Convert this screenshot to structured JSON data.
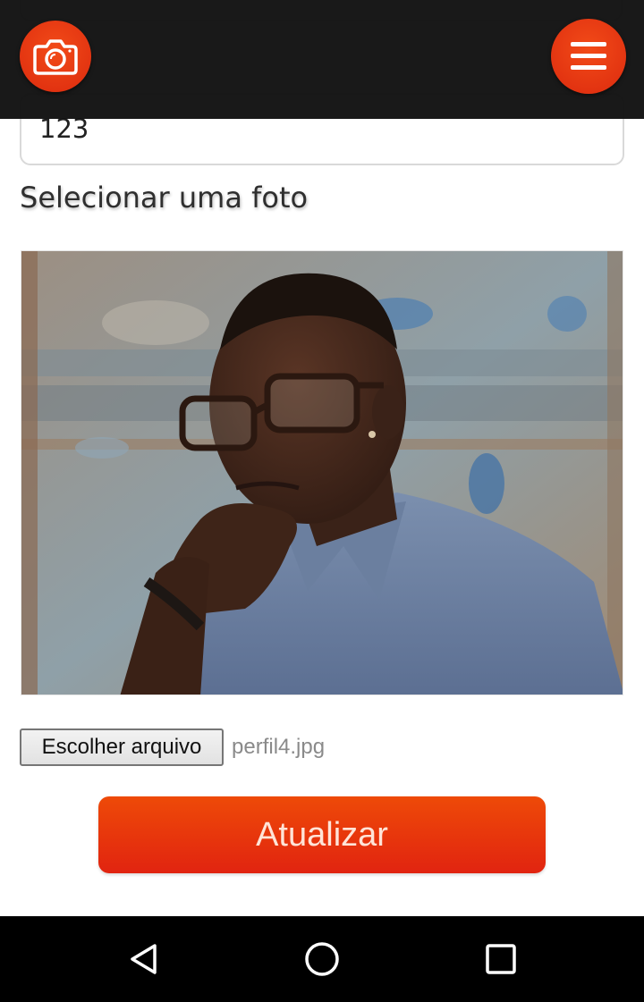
{
  "form": {
    "previous_field_value": "123",
    "photo_label": "Selecionar uma foto",
    "photo_alt": "Homem com óculos",
    "file_button_label": "Escolher arquivo",
    "file_name": "perfil4.jpg",
    "submit_label": "Atualizar"
  },
  "header": {
    "left_icon": "camera-icon",
    "right_icon": "menu-icon"
  },
  "nav": {
    "back_icon": "back-triangle-icon",
    "home_icon": "home-circle-icon",
    "recents_icon": "recents-square-icon"
  },
  "colors": {
    "accent": "#e8380c",
    "app_bar": "#121212",
    "nav_bar": "#000000"
  }
}
